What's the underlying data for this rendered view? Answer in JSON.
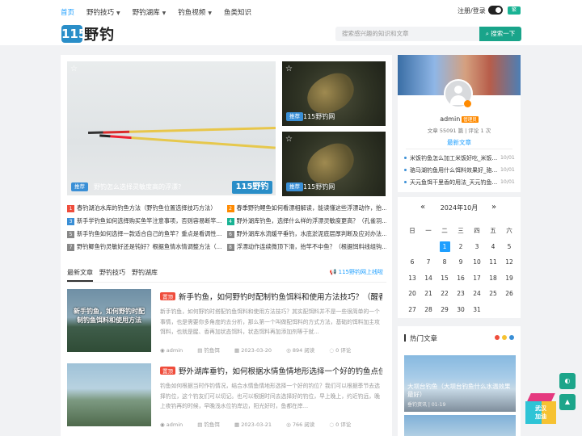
{
  "nav": {
    "links": [
      {
        "label": "首页",
        "active": true,
        "dropdown": false
      },
      {
        "label": "野钓技巧",
        "active": false,
        "dropdown": true
      },
      {
        "label": "野钓湖库",
        "active": false,
        "dropdown": true
      },
      {
        "label": "钓鱼视频",
        "active": false,
        "dropdown": true
      },
      {
        "label": "鱼类知识",
        "active": false,
        "dropdown": false
      }
    ],
    "login": "注册/登录",
    "pill": "繁"
  },
  "logo": {
    "badge": "115",
    "text": "野钓"
  },
  "search": {
    "placeholder": "搜索感兴趣的知识和文章",
    "button": "搜索一下"
  },
  "hero": {
    "tag": "推荐",
    "caption": "野钓怎么选择灵敏度高的浮漂?",
    "watermark": "115野钓"
  },
  "thumbs": [
    {
      "tag": "推荐",
      "caption": "115野钓网"
    },
    {
      "tag": "推荐",
      "caption": "115野钓网"
    }
  ],
  "top_list": [
    {
      "n": "1",
      "color": "#ef4d3c",
      "text": "春钓湖泊水库的钓鱼方法（野钓鱼位置选择技巧方法）"
    },
    {
      "n": "2",
      "color": "#ff8a00",
      "text": "春季野钓鲤鱼如何看漂相解读，能读懂这些浮漂动作，抬..."
    },
    {
      "n": "3",
      "color": "#3a8fd6",
      "text": "新手学钓鱼如何选择购买鱼竿注意事项，否则容易断竿..."
    },
    {
      "n": "4",
      "color": "#19b394",
      "text": "野外湖库钓鱼，选择什么样的浮漂灵敏度更高？（孔雀羽..."
    },
    {
      "n": "5",
      "color": "#888888",
      "text": "新手钓鱼如何选择一款适合自己的鱼竿？重点是看调性..."
    },
    {
      "n": "6",
      "color": "#888888",
      "text": "野外湖库水流缓平垂钓，水底淤泥底层厚判断及应对办法..."
    },
    {
      "n": "7",
      "color": "#888888",
      "text": "野钓鲫鱼钓灵敏好还是钝好？根据鱼情水情调整方法（..."
    },
    {
      "n": "8",
      "color": "#888888",
      "text": "浮漂动作连续微顶下滑，抬竿不中鱼？（根据饵料线组钩..."
    }
  ],
  "tabs": {
    "items": [
      "最新文章",
      "野钓技巧",
      "野钓湖库"
    ],
    "right": "115野钓网上线啦"
  },
  "articles": [
    {
      "badge": "置顶",
      "title": "新手钓鱼，如何野钓时配制钓鱼饵料和使用方法技巧？（醒香...",
      "desc": "新手钓鱼，如何野钓时搭配钓鱼饵料和使用方法技巧？其实配饵料并不是一些很简单的一个事情，也是需要你多角度的去分析，那么第一个叫做配饵料的方式方法，基础的饵料加主攻饵料，也就是腥、香再加状态饵料，状态饵料再加添加剂等于就...",
      "author": "admin",
      "category": "钓鱼饵",
      "date": "2023-03-20",
      "views": "894 阅读",
      "comments": "0 评论",
      "img_caption": "新手钓鱼，如何野钓时配制钓鱼饵料和使用方法"
    },
    {
      "badge": "置顶",
      "title": "野外湖库垂钓，如何根据水情鱼情地形选择一个好的钓鱼点位?",
      "desc": "钓鱼如何根据当时作钓情况，结合水情鱼情地形选择一个好的钓位？我们可以根据季节去选择钓位，这个钓友们可以切记。也可以根据时间去选择好的钓位，早上晚上，约近钓远，晚上夜钓再的时候，早晚浅水位钓岸边，阳光好时，鱼都在岸...",
      "author": "admin",
      "category": "钓鱼饵",
      "date": "2023-03-21",
      "views": "766 阅读",
      "comments": "0 评论"
    }
  ],
  "profile": {
    "name": "admin",
    "level": "管理员",
    "stats": "文章 55091 篇 | 评论 1 次",
    "newest_label": "最新文章",
    "posts": [
      {
        "text": "米饭钓鱼怎么加工米饭好吃_米饭...",
        "date": "10/01"
      },
      {
        "text": "骆马湖钓鱼用什么饵料效果好_骆...",
        "date": "10/01"
      },
      {
        "text": "天元鱼饵干里香的用法_天元钓鱼...",
        "date": "10/01"
      }
    ]
  },
  "calendar": {
    "title": "2024年10月",
    "weekdays": [
      "日",
      "一",
      "二",
      "三",
      "四",
      "五",
      "六"
    ],
    "weeks": [
      [
        "",
        "",
        "1",
        "2",
        "3",
        "4",
        "5"
      ],
      [
        "6",
        "7",
        "8",
        "9",
        "10",
        "11",
        "12"
      ],
      [
        "13",
        "14",
        "15",
        "16",
        "17",
        "18",
        "19"
      ],
      [
        "20",
        "21",
        "22",
        "23",
        "24",
        "25",
        "26"
      ],
      [
        "27",
        "28",
        "29",
        "30",
        "31",
        "",
        ""
      ]
    ],
    "today": "1"
  },
  "hot": {
    "title": "热门文章",
    "dot_colors": [
      "#ef4d3c",
      "#f6c232",
      "#3a8fd6"
    ],
    "caption": "大坝台钓鱼（大坝台钓鱼什么水温效果最好）",
    "meta": "垂钓资讯 | 01-19"
  },
  "cube_text": "武汉\n加油"
}
